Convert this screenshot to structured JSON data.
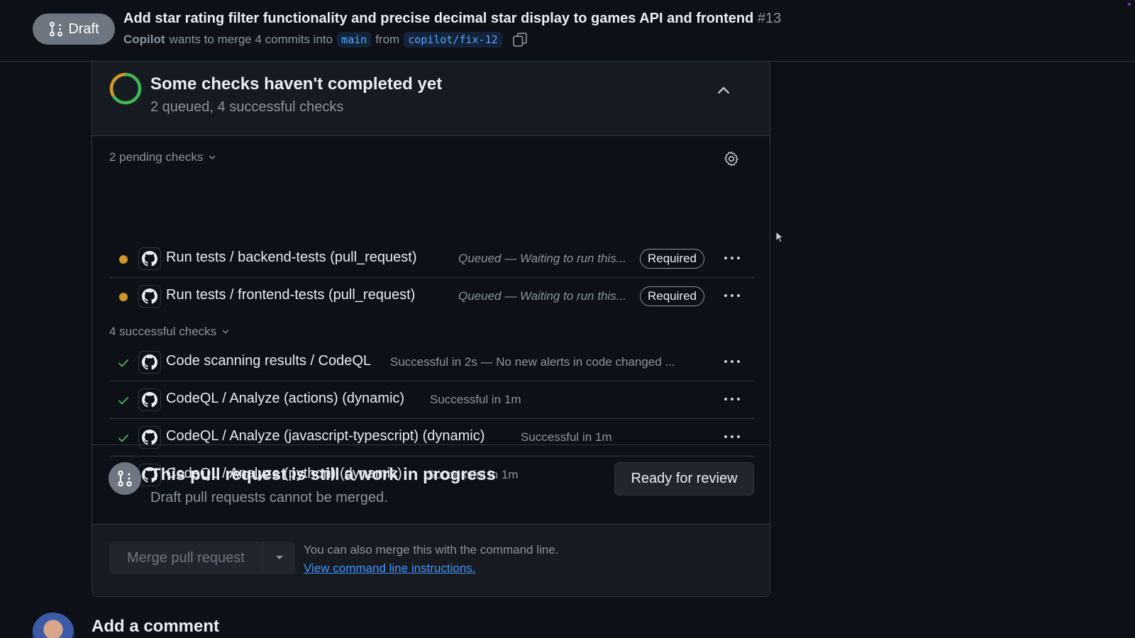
{
  "header": {
    "draft_label": "Draft",
    "title": "Add star rating filter functionality and precise decimal star display to games API and frontend",
    "number": "#13",
    "author": "Copilot",
    "merge_text_1": "wants to merge 4 commits into",
    "base_branch": "main",
    "merge_text_2": "from",
    "head_branch": "copilot/fix-12"
  },
  "checks": {
    "title": "Some checks haven't completed yet",
    "summary": "2 queued, 4 successful checks",
    "pending_label": "2 pending checks",
    "pending": [
      {
        "name": "Run tests / backend-tests (pull_request)",
        "desc": "Queued — Waiting to run this...",
        "badge": "Required"
      },
      {
        "name": "Run tests / frontend-tests (pull_request)",
        "desc": "Queued — Waiting to run this...",
        "badge": "Required"
      }
    ],
    "success_label": "4 successful checks",
    "successful": [
      {
        "name": "Code scanning results / CodeQL",
        "desc": "Successful in 2s — No new alerts in code changed ..."
      },
      {
        "name": "CodeQL / Analyze (actions) (dynamic)",
        "desc": "Successful in 1m"
      },
      {
        "name": "CodeQL / Analyze (javascript-typescript) (dynamic)",
        "desc": "Successful in 1m"
      },
      {
        "name": "CodeQL / Analyze (python) (dynamic)",
        "desc": "Successful in 1m"
      }
    ]
  },
  "wip": {
    "title": "This pull request is still a work in progress",
    "subtitle": "Draft pull requests cannot be merged.",
    "ready_button": "Ready for review"
  },
  "merge": {
    "button": "Merge pull request",
    "note": "You can also merge this with the command line.",
    "link": "View command line instructions."
  },
  "comment": {
    "heading": "Add a comment"
  },
  "colors": {
    "accent": "#4493f8",
    "success": "#3fb950",
    "pending": "#d29922"
  }
}
